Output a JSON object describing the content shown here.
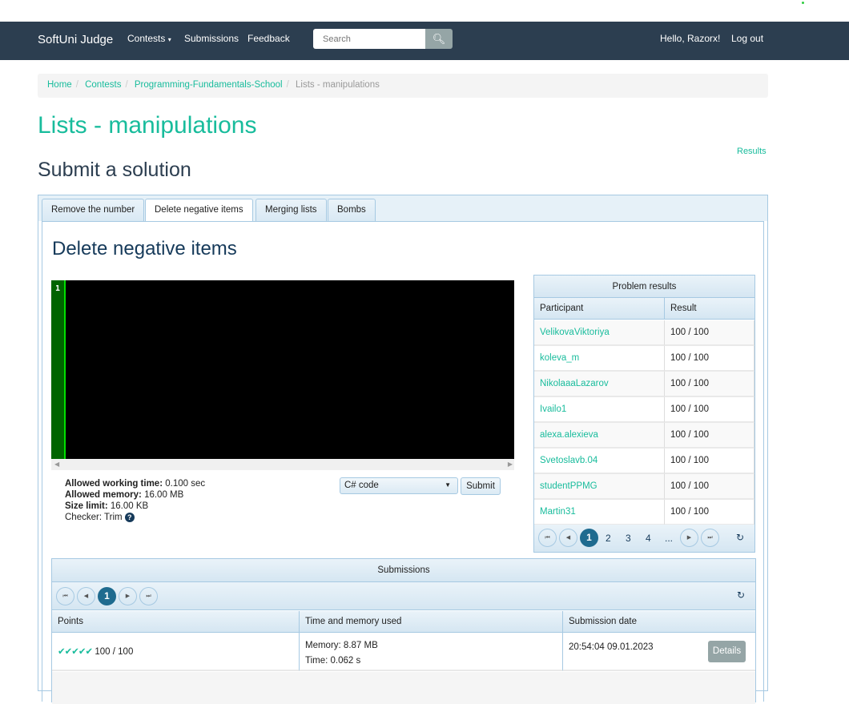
{
  "nav": {
    "brand": "SoftUni Judge",
    "contests": "Contests",
    "submissions": "Submissions",
    "feedback": "Feedback",
    "search_placeholder": "Search",
    "greeting": "Hello, Razorx!",
    "logout": "Log out"
  },
  "breadcrumb": [
    "Home",
    "Contests",
    "Programming-Fundamentals-School",
    "Lists - manipulations"
  ],
  "page_title": "Lists - manipulations",
  "results_link": "Results",
  "section_title": "Submit a solution",
  "tabs": [
    "Remove the number",
    "Delete negative items",
    "Merging lists",
    "Bombs"
  ],
  "problem_title": "Delete negative items",
  "editor": {
    "line": "1"
  },
  "limits": {
    "time_label": "Allowed working time:",
    "time": "0.100 sec",
    "memory_label": "Allowed memory:",
    "memory": "16.00 MB",
    "size_label": "Size limit:",
    "size": "16.00 KB",
    "checker_label": "Checker:",
    "checker": "Trim"
  },
  "language": "C# code",
  "submit": "Submit",
  "problem_results": {
    "title": "Problem results",
    "headers": [
      "Participant",
      "Result"
    ],
    "rows": [
      [
        "VelikovaViktoriya",
        "100 / 100"
      ],
      [
        "koleva_m",
        "100 / 100"
      ],
      [
        "NikolaaaLazarov",
        "100 / 100"
      ],
      [
        "Ivailo1",
        "100 / 100"
      ],
      [
        "alexa.alexieva",
        "100 / 100"
      ],
      [
        "Svetoslavb.04",
        "100 / 100"
      ],
      [
        "studentPPMG",
        "100 / 100"
      ],
      [
        "Martin31",
        "100 / 100"
      ]
    ],
    "pages": [
      "1",
      "2",
      "3",
      "4",
      "..."
    ]
  },
  "submissions": {
    "title": "Submissions",
    "page": "1",
    "headers": [
      "Points",
      "Time and memory used",
      "Submission date"
    ],
    "rows": [
      {
        "checks": "✔✔✔✔✔",
        "points": "100 / 100",
        "memory": "Memory: 8.87 MB",
        "time": "Time: 0.062 s",
        "date": "20:54:04 09.01.2023",
        "details": "Details"
      }
    ]
  },
  "colors": {
    "accent": "#18bc9c",
    "navbar": "#2c3e50",
    "check": "#18bc9c"
  }
}
